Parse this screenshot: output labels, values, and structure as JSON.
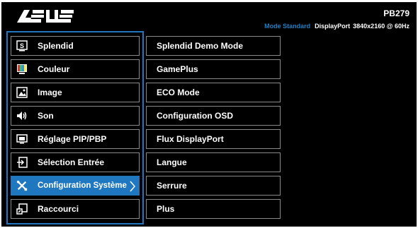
{
  "brand": "ASUS",
  "model": "PB279",
  "status": {
    "mode": "Mode Standard",
    "input": "DisplayPort",
    "resolution": "3840x2160 @ 60Hz"
  },
  "main_menu": {
    "items": [
      {
        "label": "Splendid",
        "icon": "splendid-icon"
      },
      {
        "label": "Couleur",
        "icon": "color-icon"
      },
      {
        "label": "Image",
        "icon": "image-icon"
      },
      {
        "label": "Son",
        "icon": "speaker-icon"
      },
      {
        "label": "Réglage PIP/PBP",
        "icon": "pip-icon"
      },
      {
        "label": "Sélection Entrée",
        "icon": "input-icon"
      },
      {
        "label": "Configuration Système",
        "icon": "wrench-screwdriver-icon",
        "selected": true
      },
      {
        "label": "Raccourci",
        "icon": "shortcut-icon"
      }
    ]
  },
  "sub_menu": {
    "items": [
      {
        "label": "Splendid Demo Mode"
      },
      {
        "label": "GamePlus"
      },
      {
        "label": "ECO Mode"
      },
      {
        "label": "Configuration OSD"
      },
      {
        "label": "Flux DisplayPort"
      },
      {
        "label": "Langue"
      },
      {
        "label": "Serrure"
      },
      {
        "label": "Plus"
      }
    ]
  },
  "colors": {
    "accent": "#1f78bf",
    "background": "#000000",
    "border": "#8a8a8a"
  }
}
